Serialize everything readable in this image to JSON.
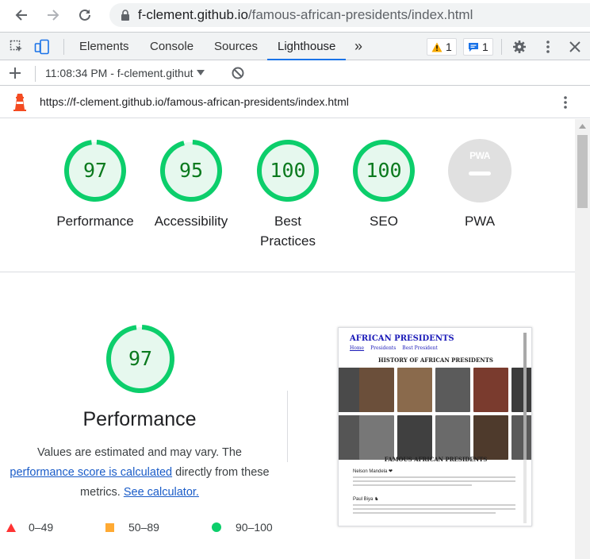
{
  "browser": {
    "url_host": "f-clement.github.io",
    "url_path": "/famous-african-presidents/index.html"
  },
  "devtools": {
    "tabs": [
      "Elements",
      "Console",
      "Sources",
      "Lighthouse"
    ],
    "active_tab": "Lighthouse",
    "warning_count": "1",
    "message_count": "1"
  },
  "lighthouse": {
    "run_label": "11:08:34 PM - f-clement.githut",
    "report_url": "https://f-clement.github.io/famous-african-presidents/index.html"
  },
  "scores": [
    {
      "label": "Performance",
      "value": "97",
      "fraction": 0.97
    },
    {
      "label": "Accessibility",
      "value": "95",
      "fraction": 0.95
    },
    {
      "label": "Best Practices",
      "value": "100",
      "fraction": 1.0
    },
    {
      "label": "SEO",
      "value": "100",
      "fraction": 1.0
    },
    {
      "label": "PWA",
      "value": "PWA"
    }
  ],
  "performance": {
    "score": "97",
    "fraction": 0.97,
    "title": "Performance",
    "desc_1": "Values are estimated and may vary. The",
    "link_1": "performance score is calculated",
    "desc_2": " directly from these",
    "desc_3": "metrics. ",
    "link_2": "See calculator."
  },
  "legend": [
    {
      "range": "0–49",
      "shape": "triangle",
      "color": "#ff3333"
    },
    {
      "range": "50–89",
      "shape": "square",
      "color": "#ffaa33"
    },
    {
      "range": "90–100",
      "shape": "circle",
      "color": "#0cce6b"
    }
  ],
  "screenshot": {
    "site_title": "AFRICAN PRESIDENTS",
    "nav": [
      "Home",
      "Presidents",
      "Best President"
    ],
    "history_heading": "HISTORY OF AFRICAN PRESIDENTS",
    "famous_heading": "FAMOUS AFRICAN PRESIDENTS",
    "entry_1": "Nelson Mandela ❤",
    "entry_2": "Paul Biya ♞"
  },
  "colors": {
    "pass": "#0cce6b",
    "pass_fill": "#e6f8ee",
    "pass_text": "#0b7a1e",
    "neutral": "#e0e0e0"
  }
}
